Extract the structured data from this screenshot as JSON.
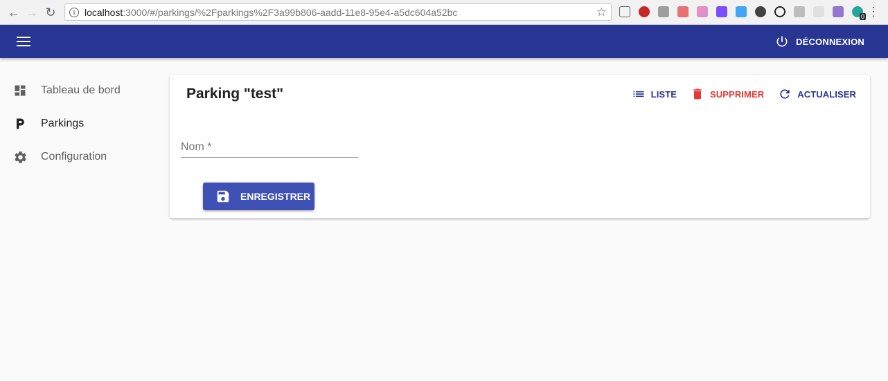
{
  "browser": {
    "url_host": "localhost",
    "url_rest": ":3000/#/parkings/%2Fparkings%2F3a99b806-aadd-11e8-95e4-a5dc604a52bc",
    "extension_badge": "0"
  },
  "appbar": {
    "logout_label": "DÉCONNEXION"
  },
  "sidebar": {
    "items": [
      {
        "label": "Tableau de bord",
        "icon": "dashboard-icon"
      },
      {
        "label": "Parkings",
        "icon": "parking-icon"
      },
      {
        "label": "Configuration",
        "icon": "settings-icon"
      }
    ]
  },
  "card": {
    "title": "Parking \"test\"",
    "actions": {
      "list_label": "LISTE",
      "delete_label": "SUPPRIMER",
      "refresh_label": "ACTUALISER"
    },
    "form": {
      "name_label": "Nom *",
      "name_value": ""
    },
    "save_label": "ENREGISTRER"
  },
  "colors": {
    "primary": "#283593",
    "button": "#3f51b5",
    "danger": "#e53935"
  }
}
